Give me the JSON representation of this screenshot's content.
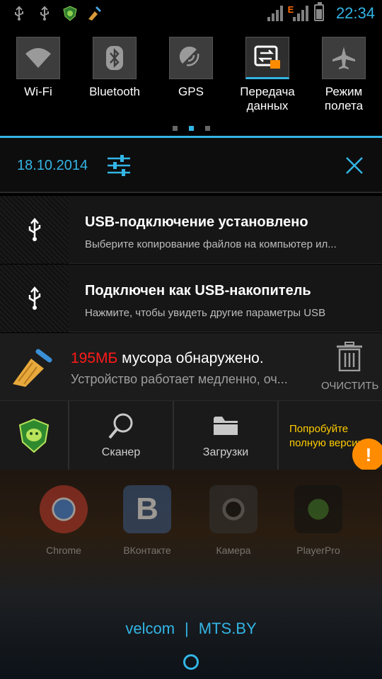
{
  "status_bar": {
    "time": "22:34",
    "icons": [
      "usb-icon",
      "usb-icon",
      "drweb-icon",
      "cleaner-icon",
      "signal-icon",
      "network-e-icon",
      "signal-icon",
      "battery-icon"
    ],
    "network_type": "E"
  },
  "quick_toggles": [
    {
      "label": "Wi-Fi",
      "icon": "wifi-icon",
      "active": false
    },
    {
      "label": "Bluetooth",
      "icon": "bluetooth-icon",
      "active": false
    },
    {
      "label": "GPS",
      "icon": "gps-icon",
      "active": false
    },
    {
      "label": "Передача\nданных",
      "icon": "data-transfer-icon",
      "active": true
    },
    {
      "label": "Режим\nполета",
      "icon": "airplane-icon",
      "active": false
    }
  ],
  "header": {
    "date": "18.10.2014"
  },
  "notifications": [
    {
      "title": "USB-подключение установлено",
      "subtitle": "Выберите копирование файлов на компьютер ил..."
    },
    {
      "title": "Подключен как USB-накопитель",
      "subtitle": "Нажмите, чтобы увидеть другие параметры USB"
    }
  ],
  "cleaner": {
    "amount": "195МБ",
    "title_rest": " мусора обнаружено.",
    "subtitle": "Устройство работает медленно, оч...",
    "clean_label": "ОЧИСТИТЬ"
  },
  "drweb_actions": {
    "scanner_label": "Сканер",
    "downloads_label": "Загрузки",
    "try_label": "Попробуйте полную версию"
  },
  "home_apps": [
    {
      "label": "Chrome",
      "color": "#c0392b"
    },
    {
      "label": "ВКонтакте",
      "color": "#3b5a86"
    },
    {
      "label": "Камера",
      "color": "#444444"
    },
    {
      "label": "PlayerPro",
      "color": "#1e3a1e"
    }
  ],
  "carrier": {
    "left": "velcom",
    "right": "MTS.BY"
  },
  "colors": {
    "accent": "#33b5e5",
    "warning": "#ff8c00",
    "junk_amount": "#ff1a1a",
    "try_text": "#ffcc00"
  }
}
